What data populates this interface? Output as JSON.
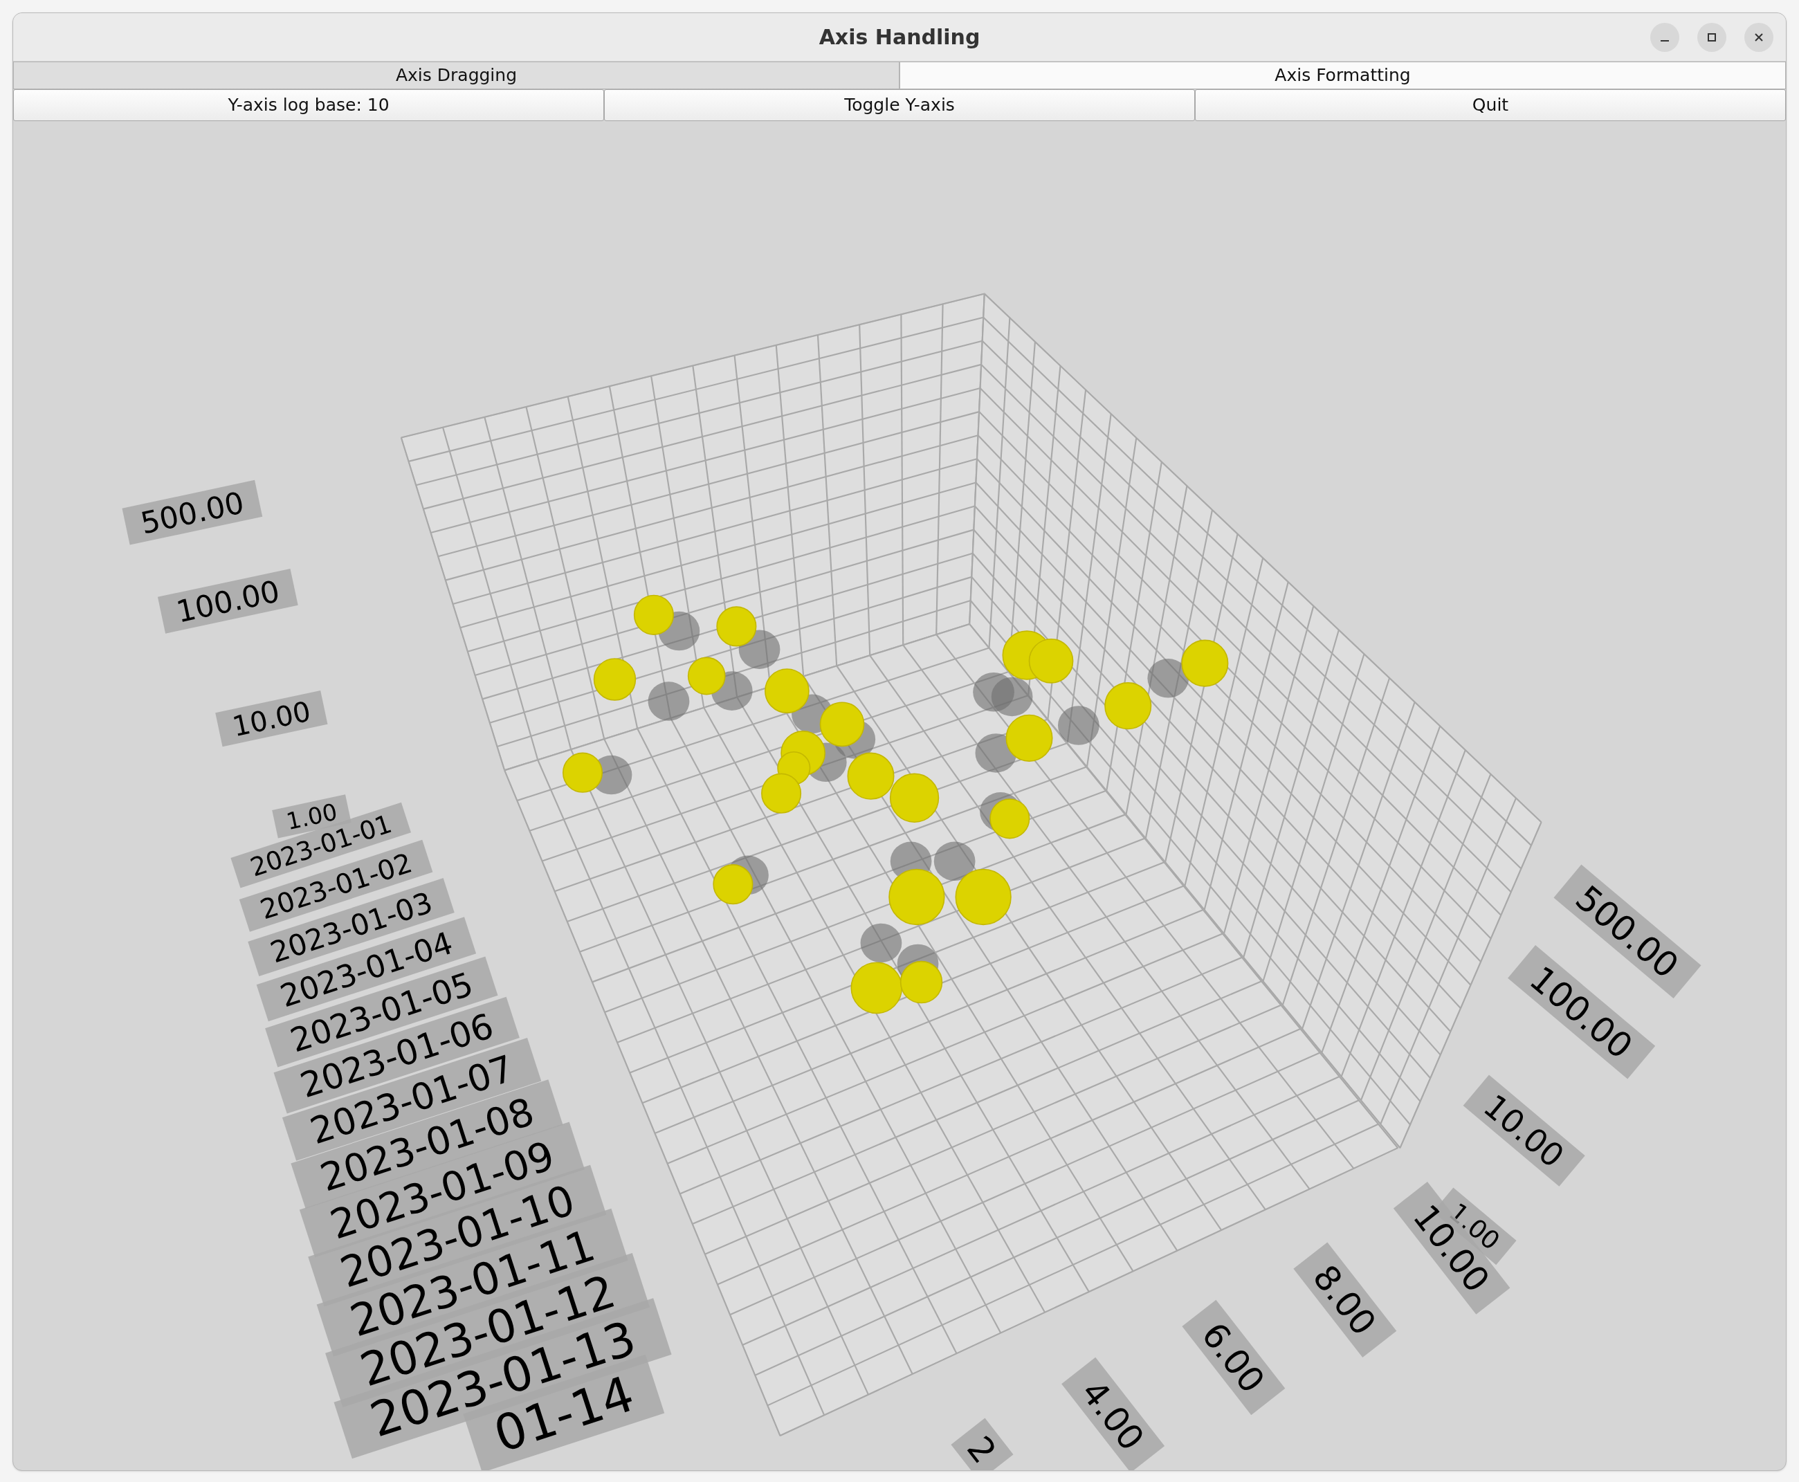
{
  "window": {
    "title": "Axis Handling"
  },
  "tabs": [
    {
      "label": "Axis Dragging",
      "selected": false
    },
    {
      "label": "Axis Formatting",
      "selected": true
    }
  ],
  "buttons": [
    "Y-axis log base: 10",
    "Toggle Y-axis",
    "Quit"
  ],
  "graph": {
    "left_value_labels": [
      "500.00",
      "100.00",
      "10.00",
      "1.00"
    ],
    "date_labels": [
      "2023-01-01",
      "2023-01-02",
      "2023-01-03",
      "2023-01-04",
      "2023-01-05",
      "2023-01-06",
      "2023-01-07",
      "2023-01-08",
      "2023-01-09",
      "2023-01-10",
      "2023-01-11",
      "2023-01-12",
      "2023-01-13",
      "01-14"
    ],
    "right_value_labels": [
      "500.00",
      "100.00",
      "10.00",
      "1.00"
    ],
    "x_labels": [
      "10.00",
      "8.00",
      "6.00",
      "4.00",
      "2"
    ]
  }
}
